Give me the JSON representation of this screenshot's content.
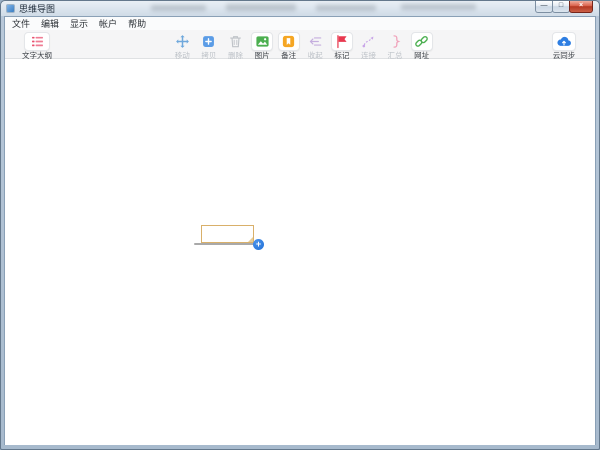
{
  "window": {
    "title": "思维导图",
    "controls": {
      "minimize": "—",
      "maximize": "□",
      "close": "×"
    }
  },
  "menubar": {
    "items": [
      {
        "label": "文件"
      },
      {
        "label": "编辑"
      },
      {
        "label": "显示"
      },
      {
        "label": "帐户"
      },
      {
        "label": "帮助"
      }
    ]
  },
  "toolbar": {
    "outline": {
      "label": "文字大纲",
      "icon": "outline-list-icon",
      "enabled": true
    },
    "tools": [
      {
        "label": "移动",
        "icon": "move-icon",
        "enabled": false
      },
      {
        "label": "拷贝",
        "icon": "copy-icon",
        "enabled": false
      },
      {
        "label": "删除",
        "icon": "delete-icon",
        "enabled": false
      },
      {
        "label": "图片",
        "icon": "picture-icon",
        "enabled": true
      },
      {
        "label": "备注",
        "icon": "note-icon",
        "enabled": true
      },
      {
        "label": "收起",
        "icon": "collapse-icon",
        "enabled": false
      },
      {
        "label": "标记",
        "icon": "flag-icon",
        "enabled": true
      },
      {
        "label": "连接",
        "icon": "connect-icon",
        "enabled": false
      },
      {
        "label": "汇总",
        "icon": "summary-icon",
        "enabled": false
      },
      {
        "label": "网址",
        "icon": "link-icon",
        "enabled": true
      }
    ],
    "sync": {
      "label": "云同步",
      "icon": "cloud-sync-icon",
      "enabled": true
    }
  },
  "canvas": {
    "topic_node": {
      "text": "",
      "add_button_glyph": "+"
    }
  },
  "colors": {
    "accent_blue": "#2e7ee2",
    "node_border": "#d9b06a",
    "outline_red": "#e8506e",
    "flag_red": "#e8384f",
    "picture_green": "#4caf50",
    "note_yellow": "#f5a623",
    "link_green": "#4db052"
  }
}
